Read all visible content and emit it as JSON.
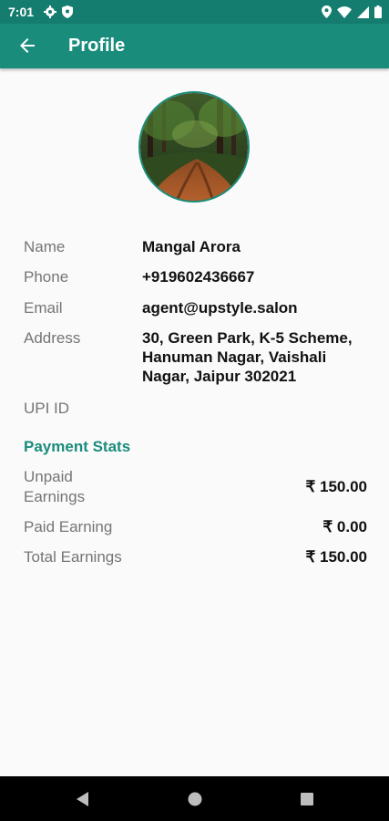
{
  "status_bar": {
    "time": "7:01",
    "left_icons": [
      "gear-icon",
      "shield-icon"
    ],
    "right_icons": [
      "location-icon",
      "wifi-icon",
      "signal-icon",
      "battery-icon"
    ]
  },
  "app_bar": {
    "title": "Profile",
    "back_icon": "arrow-back-icon"
  },
  "avatar": {
    "image": "forest-road-photo"
  },
  "profile": {
    "name_label": "Name",
    "name_value": "Mangal Arora",
    "phone_label": "Phone",
    "phone_value": "+919602436667",
    "email_label": "Email",
    "email_value": "agent@upstyle.salon",
    "address_label": "Address",
    "address_lines": [
      "30, Green Park, K-5 Scheme,",
      "Hanuman Nagar, Vaishali",
      "Nagar, Jaipur 302021"
    ],
    "upi_label": "UPI ID",
    "upi_value": ""
  },
  "payment_stats": {
    "title": "Payment Stats",
    "unpaid_label_lines": [
      "Unpaid",
      "Earnings"
    ],
    "unpaid_value": "₹ 150.00",
    "paid_label": "Paid Earning",
    "paid_value": "₹ 0.00",
    "total_label": "Total Earnings",
    "total_value": "₹ 150.00"
  },
  "colors": {
    "primary": "#1a8c7c",
    "primary_dark": "#157d6f",
    "label_grey": "#757575",
    "background": "#fafafa"
  },
  "nav_bar": {
    "buttons": [
      "back-triangle-icon",
      "home-circle-icon",
      "recents-square-icon"
    ]
  }
}
